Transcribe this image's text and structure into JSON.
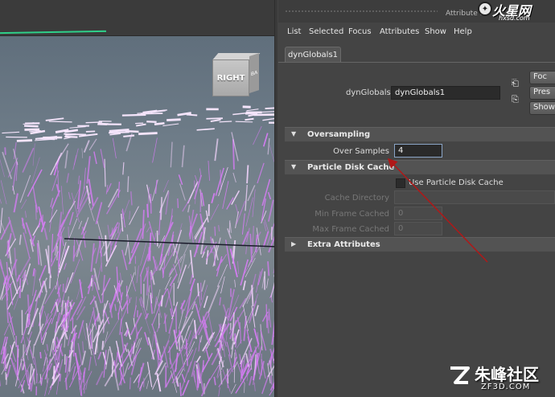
{
  "attribute_editor": {
    "title": "Attribute E",
    "menu": [
      "List",
      "Selected",
      "Focus",
      "Attributes",
      "Show",
      "Help"
    ],
    "tab": "dynGlobals1",
    "node_label": "dynGlobals:",
    "node_name": "dynGlobals1",
    "side_buttons": [
      "Foc",
      "Pres",
      "Show"
    ],
    "sections": {
      "oversampling": {
        "title": "Oversampling",
        "over_samples_label": "Over Samples",
        "over_samples_value": "4"
      },
      "particle_disk_cache": {
        "title": "Particle Disk Cache",
        "use_cache_label": "Use Particle Disk Cache",
        "cache_directory_label": "Cache Directory",
        "cache_directory_value": "",
        "min_frame_label": "Min Frame Cached",
        "min_frame_value": "0",
        "max_frame_label": "Max Frame Cached",
        "max_frame_value": "0"
      },
      "extra_attributes": {
        "title": "Extra Attributes"
      }
    }
  },
  "viewport": {
    "viewcube_face": "RIGHT",
    "viewcube_side": "BA"
  },
  "watermarks": {
    "top_logo_main": "火星网",
    "top_logo_sub": "hxsd.com",
    "bottom_logo_main": "朱峰社区",
    "bottom_logo_sub": "ZF3D.COM"
  },
  "colors": {
    "particle": "#d27cf0",
    "annotation_arrow": "#b01818",
    "active_field_border": "#8aa4c6"
  }
}
